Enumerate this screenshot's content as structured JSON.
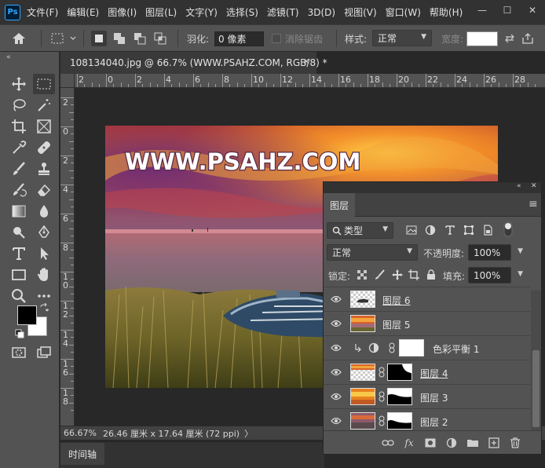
{
  "menu": {
    "logo": "Ps",
    "items": [
      "文件(F)",
      "编辑(E)",
      "图像(I)",
      "图层(L)",
      "文字(Y)",
      "选择(S)",
      "滤镜(T)",
      "3D(D)",
      "视图(V)",
      "窗口(W)",
      "帮助(H)"
    ],
    "minimize": "—",
    "restore": "☐",
    "close": "✕"
  },
  "options": {
    "feather_label": "羽化:",
    "feather_value": "0 像素",
    "antialias_label": "消除锯齿",
    "style_label": "样式:",
    "style_value": "正常",
    "width_label": "宽度:"
  },
  "toolbar": {
    "collapse": "«"
  },
  "document": {
    "tab_title": "108134040.jpg @ 66.7% (WWW.PSAHZ.COM, RGB/8) *",
    "close": "✕",
    "watermark": "WWW.PSAHZ.COM"
  },
  "rulers": {
    "h_labels": [
      "2",
      "0",
      "2",
      "4",
      "6",
      "8",
      "10",
      "12",
      "14",
      "16",
      "18",
      "20",
      "22",
      "24",
      "26",
      "28"
    ],
    "v_labels": [
      "2",
      "0",
      "2",
      "4",
      "6",
      "8",
      "1\n0",
      "1\n2",
      "1\n4",
      "1\n6",
      "1\n8"
    ]
  },
  "status": {
    "zoom": "66.67%",
    "doc_size": "26.46 厘米 x 17.64 厘米 (72 ppi)",
    "arrow": "〉"
  },
  "timeline": {
    "tab": "时间轴"
  },
  "layers_panel": {
    "collapse": "«",
    "close": "✕",
    "tab": "图层",
    "menu": "≡",
    "filter_value": "类型",
    "blend_mode": "正常",
    "opacity_label": "不透明度:",
    "opacity_value": "100%",
    "lock_label": "锁定:",
    "fill_label": "填充:",
    "fill_value": "100%",
    "layers": [
      {
        "name": "图层 6",
        "thumb": "transparent-dark",
        "mask": false
      },
      {
        "name": "图层 5",
        "thumb": "sunset",
        "mask": false
      },
      {
        "name": "色彩平衡 1",
        "thumb": "adjustment",
        "mask": "white"
      },
      {
        "name": "图层 4",
        "thumb": "transparent-sunset",
        "mask": "mask-4"
      },
      {
        "name": "图层 3",
        "thumb": "sunset-orange",
        "mask": "mask-3"
      },
      {
        "name": "图层 2",
        "thumb": "sunset-dusk",
        "mask": "mask-2"
      }
    ],
    "bottom_fx": "fx"
  },
  "colors": {
    "foreground": "#000000",
    "background": "#ffffff",
    "accent": "#31a8ff"
  }
}
